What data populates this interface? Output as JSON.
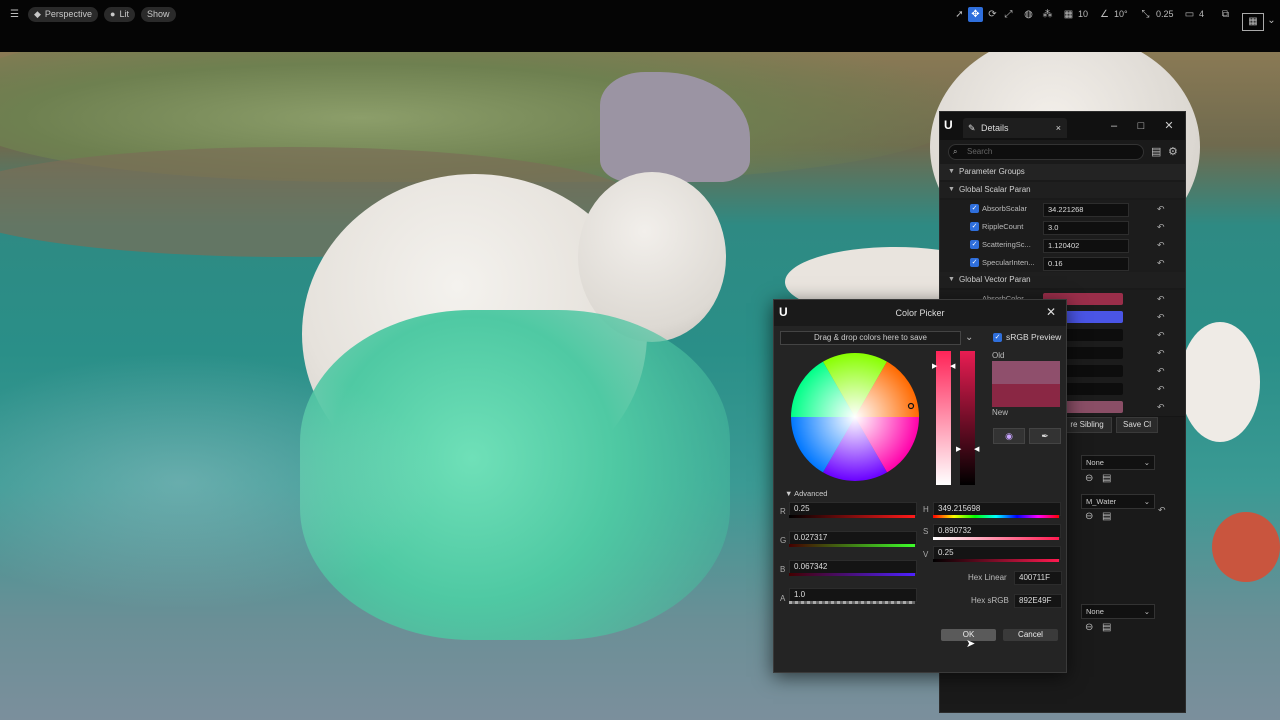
{
  "toolbar": {
    "perspective_label": "Perspective",
    "lit_label": "Lit",
    "show_label": "Show",
    "grid_snap": "10",
    "angle_snap": "10°",
    "scale_snap": "0.25",
    "camera_speed": "4"
  },
  "details": {
    "tab_label": "Details",
    "search_placeholder": "Search",
    "section_parameter_groups": "Parameter Groups",
    "section_scalar": "Global Scalar Paran",
    "section_vector": "Global Vector Paran",
    "scalar_params": [
      {
        "name": "AbsorbScalar",
        "value": "34.221268"
      },
      {
        "name": "RippleCount",
        "value": "3.0"
      },
      {
        "name": "ScatteringSc...",
        "value": "1.120402"
      },
      {
        "name": "SpecularInten...",
        "value": "0.16"
      }
    ],
    "vector_first_name": "AbsorbColor",
    "buttons": {
      "select_sibling": "re Sibling",
      "save_child": "Save Cl"
    },
    "dropdowns": {
      "none_1": "None",
      "material": "M_Water",
      "none_2": "None"
    },
    "colors": {
      "swatch_1": "#9a2e4a",
      "swatch_2": "#4a55e6",
      "swatch_7": "#8a4e66"
    }
  },
  "picker": {
    "title": "Color Picker",
    "drop_text": "Drag & drop colors here to save",
    "srgb_label": "sRGB Preview",
    "old_label": "Old",
    "new_label": "New",
    "advanced_label": "Advanced",
    "r_label": "R",
    "r_value": "0.25",
    "g_label": "G",
    "g_value": "0.027317",
    "b_label": "B",
    "b_value": "0.067342",
    "a_label": "A",
    "a_value": "1.0",
    "h_label": "H",
    "h_value": "349.215698",
    "s_label": "S",
    "s_value": "0.890732",
    "v_label": "V",
    "v_value": "0.25",
    "hex_linear_label": "Hex Linear",
    "hex_linear_value": "400711F",
    "hex_srgb_label": "Hex sRGB",
    "hex_srgb_value": "892E49F",
    "ok_label": "OK",
    "cancel_label": "Cancel",
    "colors": {
      "old": "#8f4f6c",
      "new": "#8a2744"
    }
  }
}
